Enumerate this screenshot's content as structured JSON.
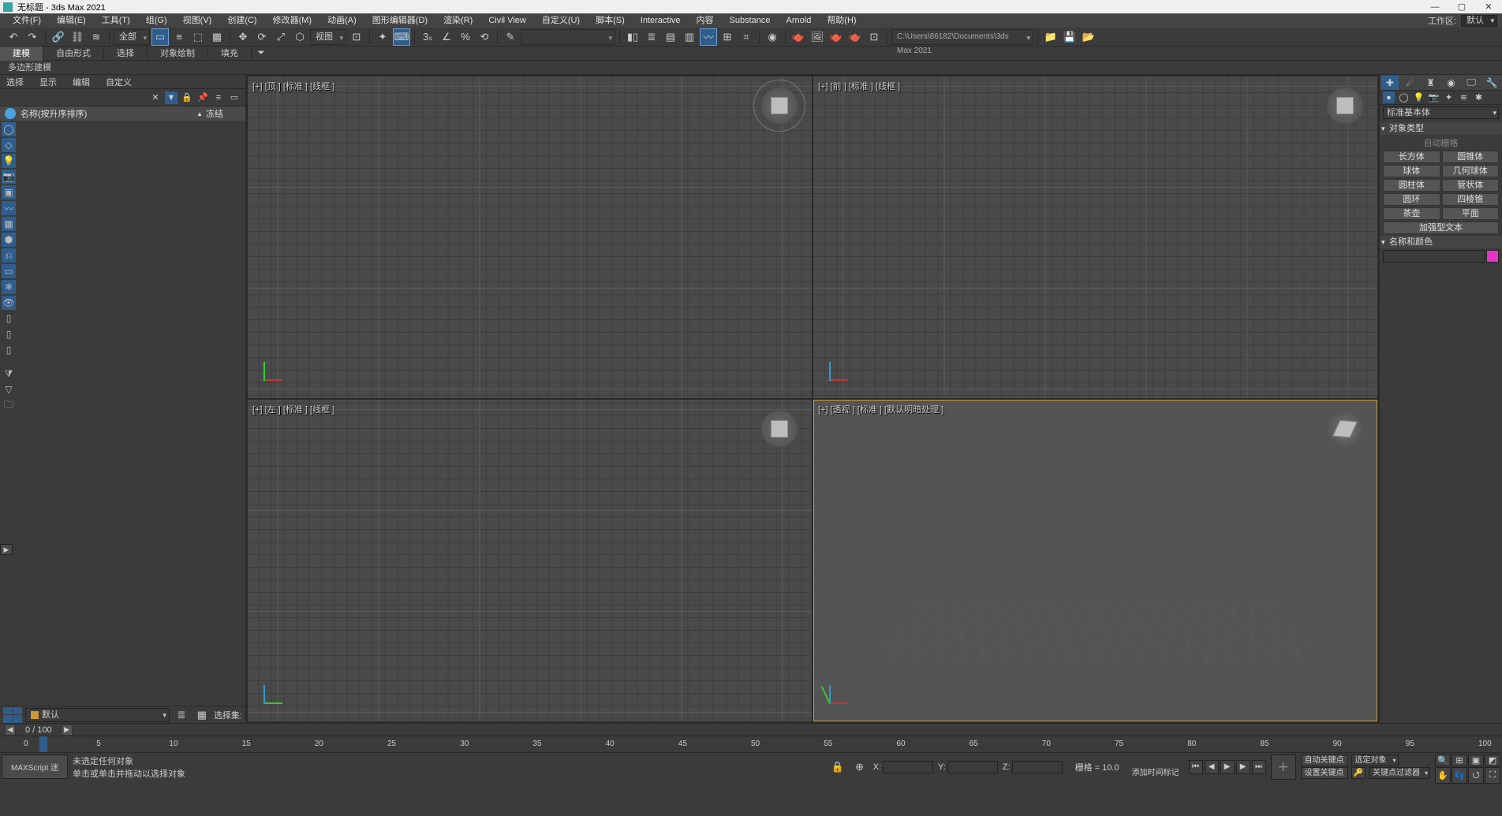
{
  "title": "无标题 - 3ds Max 2021",
  "menu": [
    "文件(F)",
    "编辑(E)",
    "工具(T)",
    "组(G)",
    "视图(V)",
    "创建(C)",
    "修改器(M)",
    "动画(A)",
    "图形编辑器(D)",
    "渲染(R)",
    "Civil View",
    "自定义(U)",
    "脚本(S)",
    "Interactive",
    "内容",
    "Substance",
    "Arnold",
    "帮助(H)"
  ],
  "workspace_label": "工作区:",
  "workspace_value": "默认",
  "toolbar_scope": "全部",
  "toolbar_view": "视图",
  "project_path": "C:\\Users\\86182\\Documents\\3ds Max 2021",
  "ribbon_tabs": [
    "建模",
    "自由形式",
    "选择",
    "对象绘制",
    "填充"
  ],
  "ribbon_sub": "多边形建模",
  "scene_tabs": [
    "选择",
    "显示",
    "编辑",
    "自定义"
  ],
  "scene_header_name": "名称(按升序排序)",
  "scene_header_freeze": "冻结",
  "layer_default": "默认",
  "selset_label": "选择集:",
  "viewports": {
    "tl": "[+] [顶 ] [标准 ] [线框 ]",
    "tr": "[+] [前 ] [标准 ] [线框 ]",
    "bl": "[+] [左 ] [标准 ] [线框 ]",
    "br": "[+] [透视 ] [标准 ] [默认明暗处理 ]"
  },
  "cmd": {
    "category": "标准基本体",
    "roll_objtype": "对象类型",
    "autogrid": "自动栅格",
    "obj_buttons": [
      "长方体",
      "圆锥体",
      "球体",
      "几何球体",
      "圆柱体",
      "管状体",
      "圆环",
      "四棱锥",
      "茶壶",
      "平面"
    ],
    "obj_text": "加强型文本",
    "roll_namecolor": "名称和颜色"
  },
  "frame_counter": "0 / 100",
  "time_ticks": [
    "0",
    "5",
    "10",
    "15",
    "20",
    "25",
    "30",
    "35",
    "40",
    "45",
    "50",
    "55",
    "60",
    "65",
    "70",
    "75",
    "80",
    "85",
    "90",
    "95",
    "100"
  ],
  "maxscript": "MAXScript 迷",
  "status_line1": "未选定任何对象",
  "status_line2": "单击或单击并拖动以选择对象",
  "coord_labels": {
    "x": "X:",
    "y": "Y:",
    "z": "Z:"
  },
  "grid_label": "栅格 = 10.0",
  "addtime": "添加时间标记",
  "key_buttons": {
    "auto": "自动关键点",
    "set": "设置关键点"
  },
  "key_dd": {
    "sel": "选定对象",
    "filter": "关键点过滤器"
  },
  "color_swatch": "#e535c5"
}
